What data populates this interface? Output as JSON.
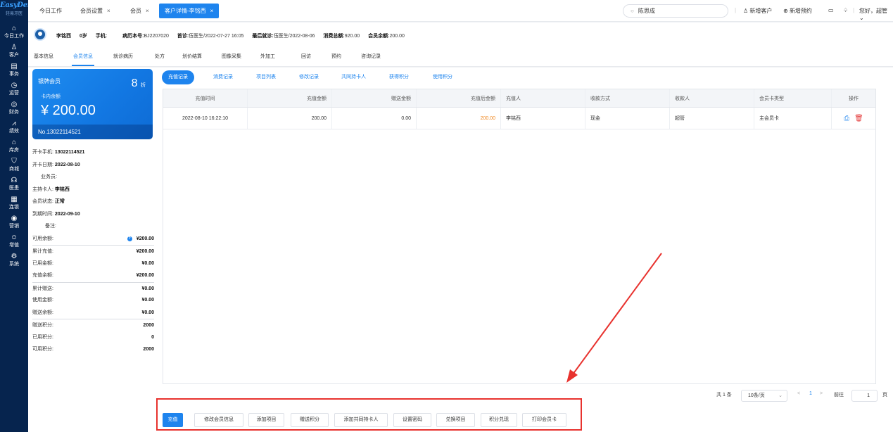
{
  "brand": {
    "logo": "EasyDent",
    "sub": "轻易牙医"
  },
  "nav": [
    {
      "icon": "⌂",
      "label": "今日工作"
    },
    {
      "icon": "♙",
      "label": "客户"
    },
    {
      "icon": "▤",
      "label": "事务"
    },
    {
      "icon": "◷",
      "label": "运营"
    },
    {
      "icon": "◎",
      "label": "财务"
    },
    {
      "icon": "⩘",
      "label": "绩效"
    },
    {
      "icon": "⌂",
      "label": "库房"
    },
    {
      "icon": "⛉",
      "label": "商城"
    },
    {
      "icon": "☊",
      "label": "医患"
    },
    {
      "icon": "▦",
      "label": "连锁"
    },
    {
      "icon": "◉",
      "label": "营销"
    },
    {
      "icon": "☺",
      "label": "增值"
    },
    {
      "icon": "⚙",
      "label": "系统"
    }
  ],
  "tabs": [
    {
      "label": "今日工作",
      "close": ""
    },
    {
      "label": "会员设置",
      "close": "×"
    },
    {
      "label": "会员",
      "close": "×"
    },
    {
      "label": "客户详情-李铭西",
      "close": "×"
    }
  ],
  "search": {
    "icon": "search-icon",
    "value": "陈思成"
  },
  "topright": {
    "new_customer": "新增客户",
    "new_appointment": "新增预约",
    "greeting": "您好，超管"
  },
  "patient": {
    "name": "李铭西",
    "age": "0岁",
    "phone_label": "手机:",
    "phone": "",
    "record_label": "病历本号:",
    "record": "BJ2207020",
    "first_label": "首诊:",
    "first": "伍医生/2022-07-27 16:05",
    "last_label": "最后就诊:",
    "last": "伍医生/2022-08-06",
    "spend_label": "消费总额:",
    "spend": "920.00",
    "balance_label": "会员余额:",
    "balance": "200.00"
  },
  "subtabs": [
    "基本信息",
    "会员信息",
    "就诊病历",
    "处方",
    "划价结算",
    "图像采集",
    "外加工",
    "回访",
    "预约",
    "咨询记录"
  ],
  "card": {
    "level": "银牌会员",
    "discount": "8",
    "discount_unit": "折",
    "balance_label": "卡内余额",
    "balance": "¥ 200.00",
    "card_no": "No.13022114521"
  },
  "info": {
    "phone_label": "开卡手机:",
    "phone": "13022114521",
    "date_label": "开卡日期:",
    "date": "2022-08-10",
    "sales_label": "业务员:",
    "sales": "",
    "holder_label": "主持卡人:",
    "holder": "李铭西",
    "status_label": "会员状态:",
    "status": "正常",
    "expire_label": "到期时间:",
    "expire": "2022-09-10",
    "note_label": "备注:",
    "note": "",
    "available_label": "可用余额:",
    "available": "¥200.00",
    "total_recharge_label": "累计充值:",
    "total_recharge": "¥200.00",
    "used_label": "已用金额:",
    "used": "¥0.00",
    "recharge_amount_label": "充值余额:",
    "recharge_amount": "¥200.00",
    "total_gift_label": "累计赠送:",
    "total_gift": "¥0.00",
    "gift_used_label": "使用金额:",
    "gift_used": "¥0.00",
    "gift_balance_label": "赠送余额:",
    "gift_balance": "¥0.00",
    "gift_points_label": "赠送积分:",
    "gift_points": "2000",
    "used_points_label": "已用积分:",
    "used_points": "0",
    "avail_points_label": "可用积分:",
    "avail_points": "2000"
  },
  "record_tabs": [
    "充值记录",
    "消费记录",
    "项目列表",
    "修改记录",
    "共同持卡人",
    "获得积分",
    "使用积分"
  ],
  "table": {
    "headers": [
      "充值时间",
      "充值金额",
      "赠送金额",
      "充值后金额",
      "充值人",
      "收款方式",
      "收款人",
      "会员卡类型",
      "操作"
    ],
    "rows": [
      [
        "2022-08-10 16:22:10",
        "200.00",
        "0.00",
        "200.00",
        "李铭西",
        "现金",
        "超管",
        "主会员卡"
      ]
    ]
  },
  "pagination": {
    "total": "共 1 条",
    "page_size": "10条/页",
    "prev": "<",
    "page": "1",
    "next": ">",
    "goto_label": "前往",
    "goto_value": "1",
    "page_unit": "页"
  },
  "actions": [
    "充值",
    "修改会员信息",
    "添加项目",
    "赠送积分",
    "添加共同持卡人",
    "设置密码",
    "兑换项目",
    "积分兑现",
    "打印会员卡"
  ]
}
